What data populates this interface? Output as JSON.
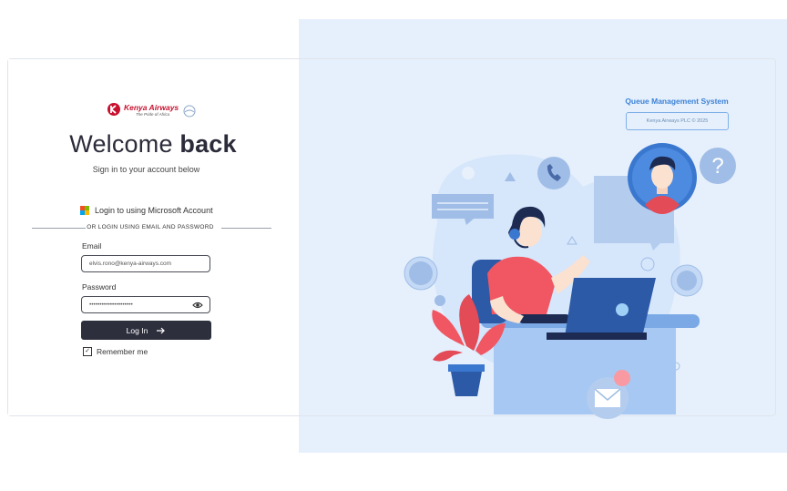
{
  "brand": {
    "name": "Kenya Airways",
    "tagline": "The Pride of Africa",
    "color": "#c8102e"
  },
  "login": {
    "heading_light": "Welcome ",
    "heading_bold": "back",
    "subheading": "Sign in to your account below",
    "microsoft_label": "Login to using Microsoft Account",
    "divider_text": "OR LOGIN USING EMAIL AND PASSWORD",
    "email_label": "Email",
    "email_value": "elvis.rono@kenya-airways.com",
    "password_label": "Password",
    "password_value": "•••••••••••••••••••••",
    "login_button": "Log In",
    "remember_label": "Remember me",
    "remember_checked": true
  },
  "side": {
    "title": "Queue Management System",
    "copyright": "Kenya Airways PLC © 2025",
    "illustration": "customer-support-agent-illustration"
  },
  "colors": {
    "primary_dark": "#2d2f3d",
    "accent_blue": "#3b82d6",
    "panel_bg": "#e6f0fc"
  }
}
